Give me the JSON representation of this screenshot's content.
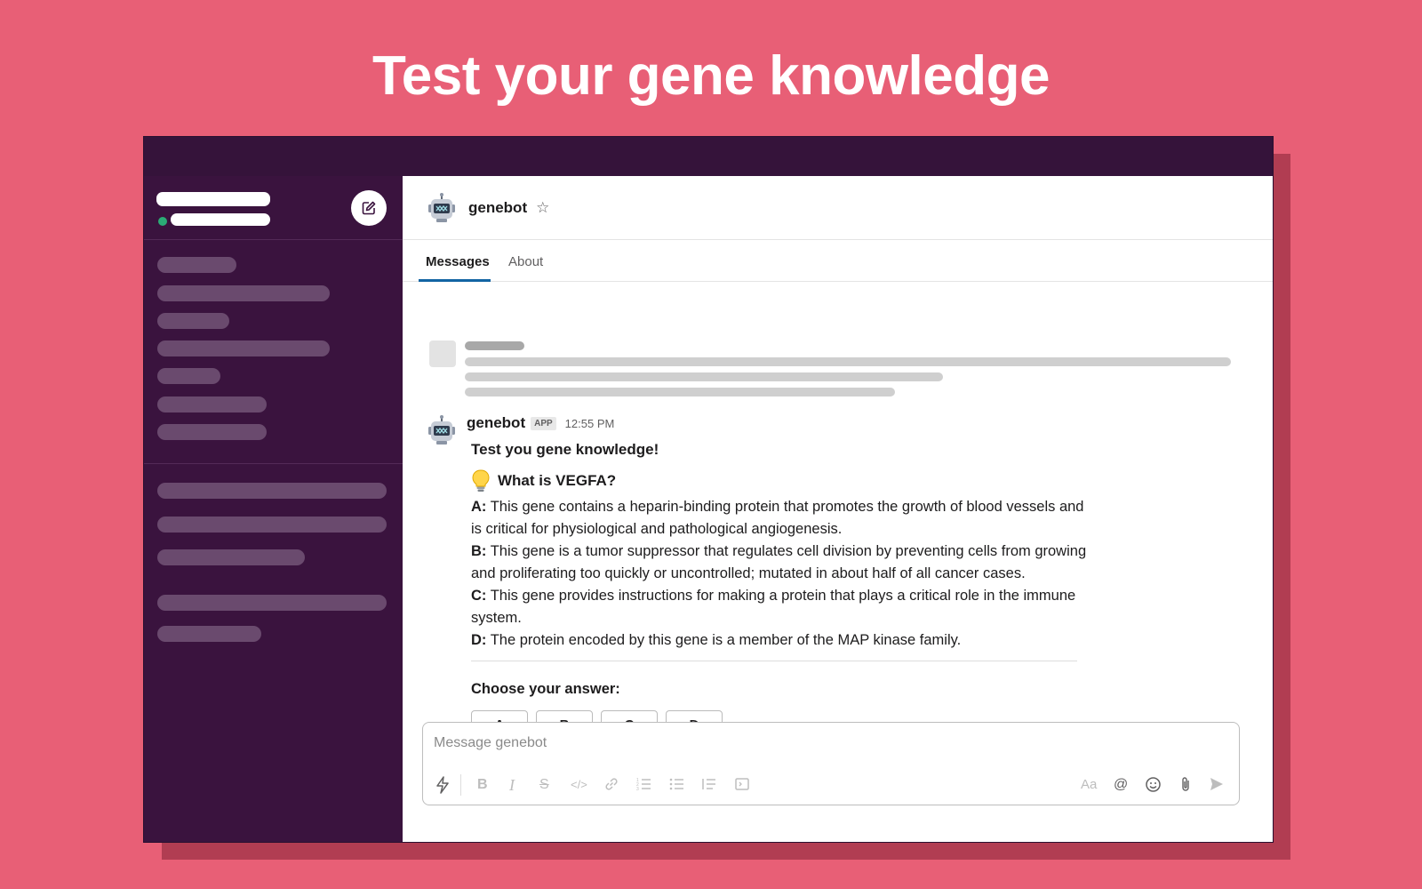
{
  "headline": "Test your gene knowledge",
  "channel": {
    "name": "genebot",
    "tabs": [
      {
        "label": "Messages",
        "active": true
      },
      {
        "label": "About",
        "active": false
      }
    ]
  },
  "message": {
    "author": "genebot",
    "badge": "APP",
    "time": "12:55 PM",
    "intro": "Test you gene knowledge!",
    "question": "What is VEGFA?",
    "options": [
      {
        "letter": "A:",
        "text": "This gene contains a heparin-binding protein that promotes the growth of blood vessels and is critical for physiological and pathological angiogenesis."
      },
      {
        "letter": "B:",
        "text": "This gene is a tumor suppressor that regulates cell division by preventing cells from growing and proliferating too quickly or uncontrolled; mutated in about half of all cancer cases."
      },
      {
        "letter": "C:",
        "text": "This gene provides instructions for making a protein that plays a critical role in the immune system."
      },
      {
        "letter": "D:",
        "text": "The protein encoded by this gene is a member of the MAP kinase family."
      }
    ],
    "choose_label": "Choose your answer:",
    "buttons": [
      "A",
      "B",
      "C",
      "D"
    ]
  },
  "composer": {
    "placeholder": "Message genebot",
    "format_hint": "Aa"
  },
  "colors": {
    "background": "#e85f76",
    "sidebar": "#3a133e",
    "topbar": "#35133a",
    "online": "#2bac76"
  }
}
